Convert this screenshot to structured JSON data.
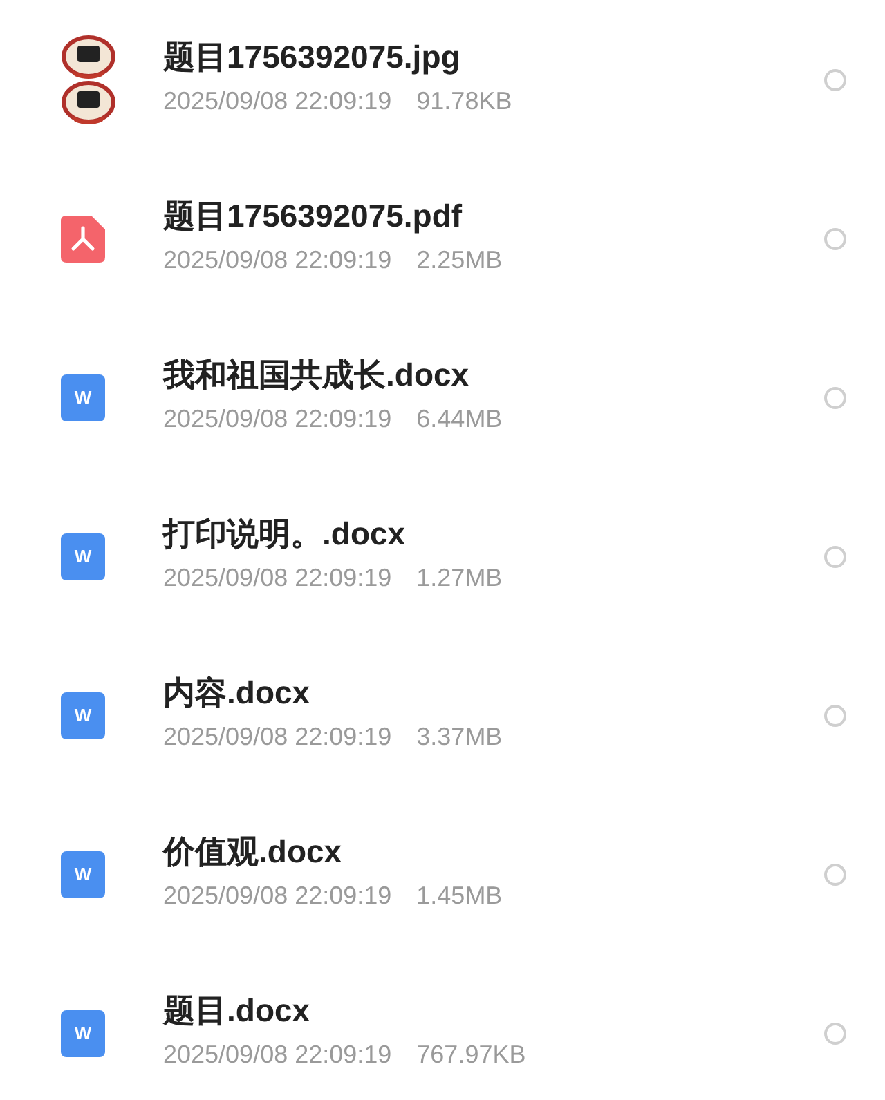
{
  "files": [
    {
      "name": "题目1756392075.jpg",
      "date": "2025/09/08 22:09:19",
      "size": "91.78KB",
      "selected": false
    },
    {
      "kind": "pdf",
      "name": "题目1756392075.pdf",
      "date": "2025/09/08 22:09:19",
      "size": "2.25MB",
      "selected": false
    },
    {
      "kind": "word",
      "icon_letter": "W",
      "name": "我和祖国共成长.docx",
      "date": "2025/09/08 22:09:19",
      "size": "6.44MB",
      "selected": false
    },
    {
      "kind": "word",
      "icon_letter": "W",
      "name": "打印说明。.docx",
      "date": "2025/09/08 22:09:19",
      "size": "1.27MB",
      "selected": false
    },
    {
      "kind": "word",
      "icon_letter": "W",
      "name": "内容.docx",
      "date": "2025/09/08 22:09:19",
      "size": "3.37MB",
      "selected": false
    },
    {
      "kind": "word",
      "icon_letter": "W",
      "name": "价值观.docx",
      "date": "2025/09/08 22:09:19",
      "size": "1.45MB",
      "selected": false
    },
    {
      "kind": "word",
      "icon_letter": "W",
      "name": "题目.docx",
      "date": "2025/09/08 22:09:19",
      "size": "767.97KB",
      "selected": false
    }
  ]
}
